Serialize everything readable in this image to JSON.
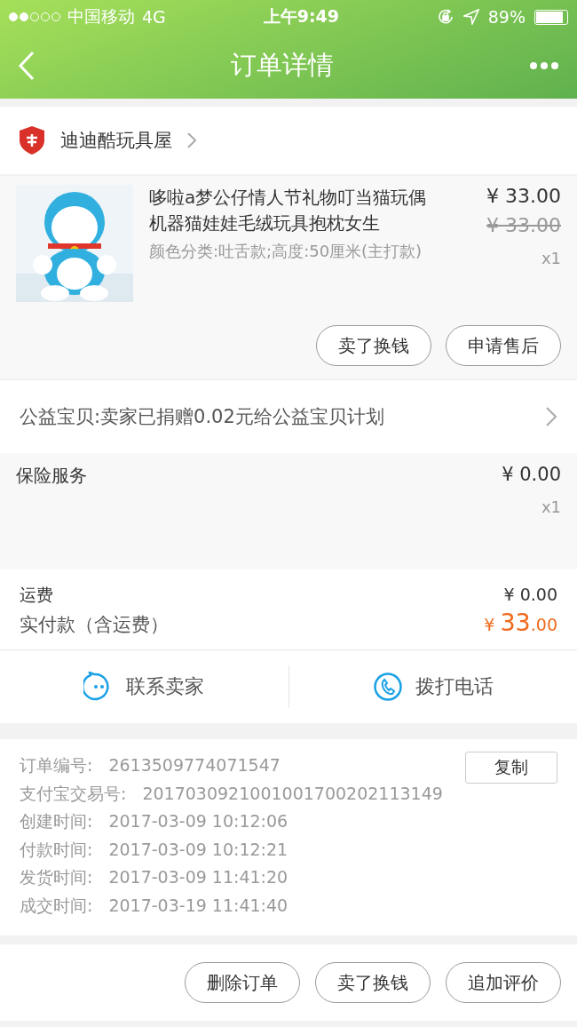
{
  "status_bar": {
    "carrier": "中国移动",
    "network": "4G",
    "time": "上午9:49",
    "battery": "89%"
  },
  "nav": {
    "title": "订单详情"
  },
  "shop": {
    "name": "迪迪酷玩具屋"
  },
  "product": {
    "title": "哆啦a梦公仔情人节礼物叮当猫玩偶机器猫娃娃毛绒玩具抱枕女生",
    "sku": "颜色分类:吐舌款;高度:50厘米(主打款)",
    "price": "¥ 33.00",
    "original_price": "¥ 33.00",
    "quantity": "x1",
    "actions": [
      "卖了换钱",
      "申请售后"
    ]
  },
  "charity": {
    "text": "公益宝贝:卖家已捐赠0.02元给公益宝贝计划"
  },
  "insurance": {
    "label": "保险服务",
    "price": "¥ 0.00",
    "quantity": "x1"
  },
  "shipping": {
    "label": "运费",
    "value": "¥ 0.00"
  },
  "paid": {
    "label": "实付款（含运费）",
    "currency": "¥",
    "integer": "33",
    "decimal": ".00"
  },
  "contact": [
    {
      "kind": "chat",
      "label": "联系卖家"
    },
    {
      "kind": "phone",
      "label": "拨打电话"
    }
  ],
  "info": {
    "copy_button": "复制",
    "rows": [
      {
        "label": "订单编号:",
        "value": "2613509774071547"
      },
      {
        "label": "支付宝交易号:",
        "value": "2017030921001001700202113149"
      },
      {
        "label": "创建时间:",
        "value": "2017-03-09 10:12:06"
      },
      {
        "label": "付款时间:",
        "value": "2017-03-09 10:12:21"
      },
      {
        "label": "发货时间:",
        "value": "2017-03-09 11:41:20"
      },
      {
        "label": "成交时间:",
        "value": "2017-03-19 11:41:40"
      }
    ]
  },
  "footer_actions": [
    "删除订单",
    "卖了换钱",
    "追加评价"
  ]
}
